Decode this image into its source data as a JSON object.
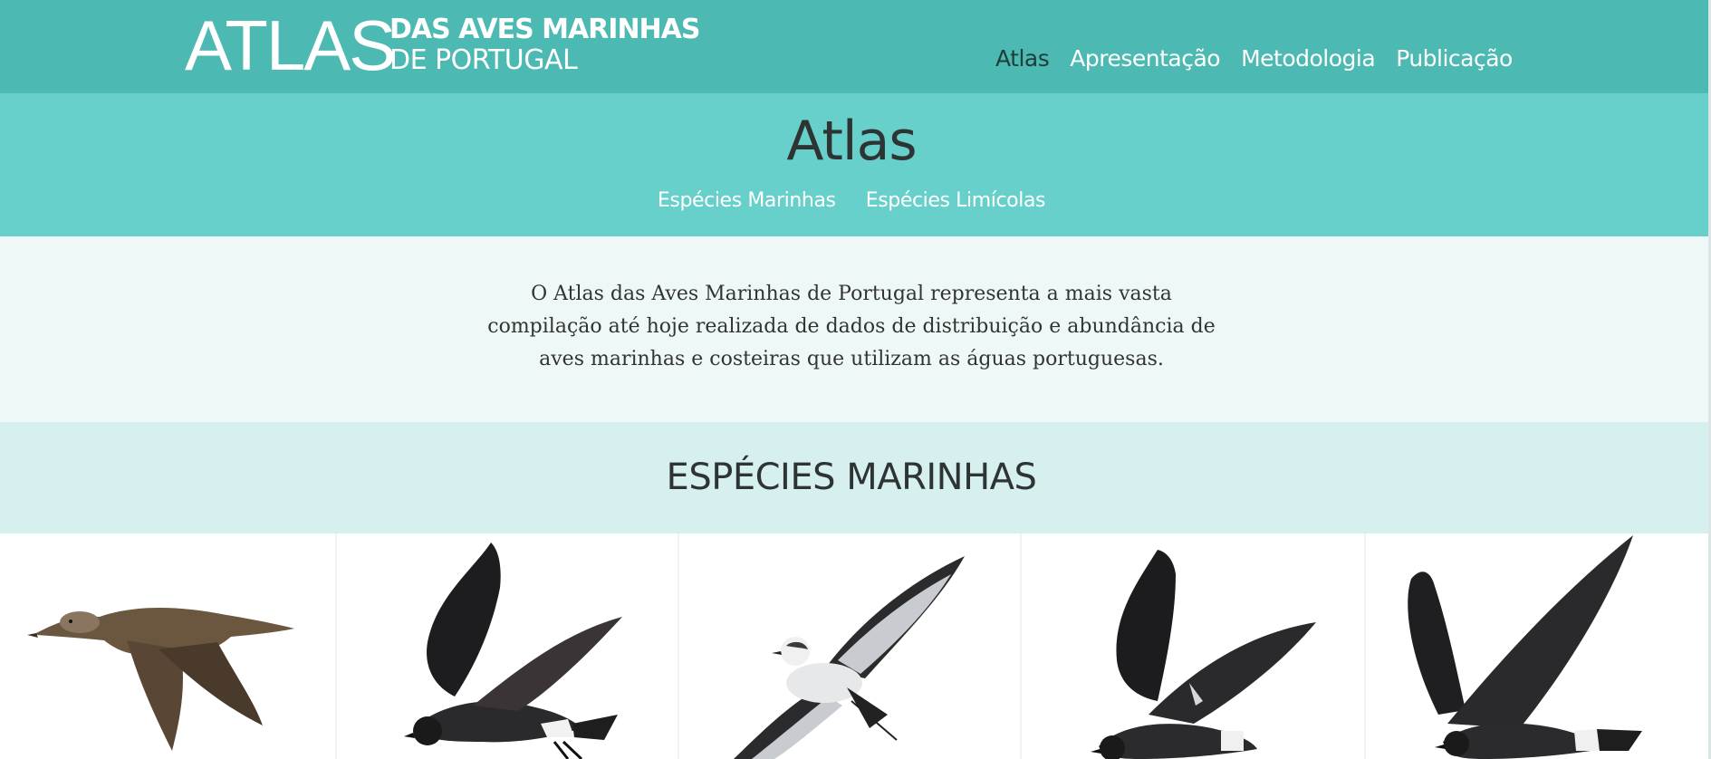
{
  "header": {
    "logo_main": "ATLAS",
    "logo_line1": "DAS AVES MARINHAS",
    "logo_line2": "DE PORTUGAL",
    "nav": [
      "Atlas",
      "Apresentação",
      "Metodologia",
      "Publicação"
    ],
    "active_nav": "Atlas"
  },
  "atlas": {
    "title": "Atlas",
    "subnav": [
      "Espécies Marinhas",
      "Espécies Limícolas"
    ]
  },
  "intro": {
    "text": "O Atlas das Aves Marinhas de Portugal representa a mais vasta compilação até hoje realizada de dados de distribuição e abundância de aves marinhas e costeiras que utilizam as águas portuguesas."
  },
  "section": {
    "title": "ESPÉCIES MARINHAS"
  },
  "species_cards": [
    {
      "icon": "brown-duck-icon"
    },
    {
      "icon": "dark-storm-petrel-icon"
    },
    {
      "icon": "white-faced-storm-petrel-icon"
    },
    {
      "icon": "band-rumped-storm-petrel-icon"
    },
    {
      "icon": "leach-storm-petrel-icon"
    }
  ],
  "colors": {
    "header_bg": "#4cb9b2",
    "atlas_band_bg": "#67d0ca",
    "intro_bg": "#eef9f7",
    "section_bg": "#d5f0ee",
    "active_nav": "#1f3d3b"
  }
}
